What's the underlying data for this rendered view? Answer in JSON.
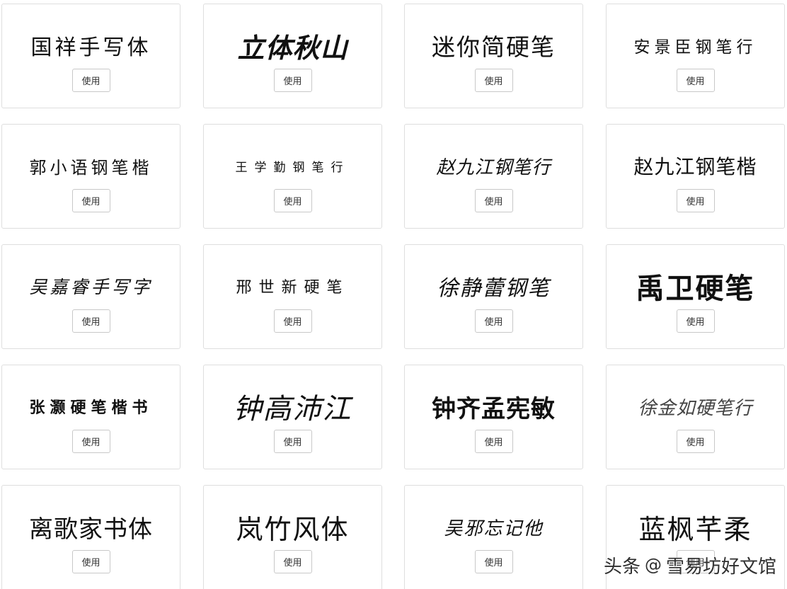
{
  "fonts": [
    {
      "name": "国祥手写体",
      "button": "使用"
    },
    {
      "name": "立体秋山",
      "button": "使用"
    },
    {
      "name": "迷你简硬笔",
      "button": "使用"
    },
    {
      "name": "安景臣钢笔行",
      "button": "使用"
    },
    {
      "name": "郭小语钢笔楷",
      "button": "使用"
    },
    {
      "name": "王学勤钢笔行",
      "button": "使用"
    },
    {
      "name": "赵九江钢笔行",
      "button": "使用"
    },
    {
      "name": "赵九江钢笔楷",
      "button": "使用"
    },
    {
      "name": "吴嘉睿手写字",
      "button": "使用"
    },
    {
      "name": "邢世新硬笔",
      "button": "使用"
    },
    {
      "name": "徐静蕾钢笔",
      "button": "使用"
    },
    {
      "name": "禹卫硬笔",
      "button": "使用"
    },
    {
      "name": "张灏硬笔楷书",
      "button": "使用"
    },
    {
      "name": "钟高沛江",
      "button": "使用"
    },
    {
      "name": "钟齐孟宪敏",
      "button": "使用"
    },
    {
      "name": "徐金如硬笔行",
      "button": "使用"
    },
    {
      "name": "离歌家书体",
      "button": "使用"
    },
    {
      "name": "岚竹风体",
      "button": "使用"
    },
    {
      "name": "吴邪忘记他",
      "button": "使用"
    },
    {
      "name": "蓝枫芊柔",
      "button": "使用"
    }
  ],
  "watermark": {
    "brand": "头条",
    "at": "@",
    "author": "雪易坊好文馆"
  }
}
